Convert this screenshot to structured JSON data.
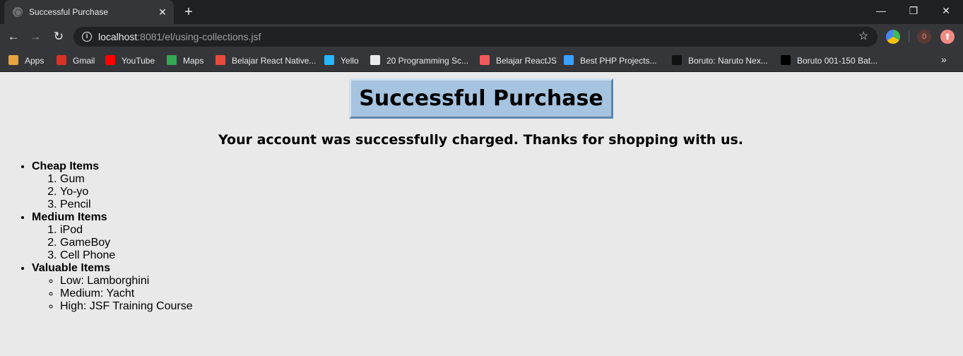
{
  "browser": {
    "tab": {
      "title": "Successful Purchase",
      "close": "✕"
    },
    "new_tab": "+",
    "window": {
      "minimize": "—",
      "maximize": "❐",
      "close": "✕"
    },
    "nav": {
      "back": "←",
      "forward": "→",
      "reload": "↻"
    },
    "address": {
      "host": "localhost",
      "rest": ":8081/el/using-collections.jsf"
    },
    "extension_badge": "0",
    "bookmarks": [
      {
        "label": "Apps",
        "icon": "apps-grid-icon",
        "color": "#e8a33d"
      },
      {
        "label": "Gmail",
        "icon": "gmail-icon",
        "color": "#d93025"
      },
      {
        "label": "YouTube",
        "icon": "youtube-icon",
        "color": "#ff0000"
      },
      {
        "label": "Maps",
        "icon": "maps-icon",
        "color": "#34a853"
      },
      {
        "label": "Belajar React Native...",
        "icon": "dw-icon",
        "color": "#e94b3c"
      },
      {
        "label": "Yello",
        "icon": "yello-icon",
        "color": "#29b6f6"
      },
      {
        "label": "20 Programming Sc...",
        "icon": "globe-icon",
        "color": "#e8eaed"
      },
      {
        "label": "Belajar ReactJS",
        "icon": "react-icon",
        "color": "#f05a5a"
      },
      {
        "label": "Best PHP Projects...",
        "icon": "nsc-icon",
        "color": "#3aa0ff"
      },
      {
        "label": "Boruto: Naruto Nex...",
        "icon": "cat-icon",
        "color": "#111111"
      },
      {
        "label": "Boruto 001-150 Bat...",
        "icon": "question-icon",
        "color": "#000000"
      }
    ],
    "bookmarks_more": "»"
  },
  "page": {
    "title": "Successful Purchase",
    "message": "Your account was successfully charged. Thanks for shopping with us.",
    "categories": [
      {
        "name": "Cheap Items",
        "items": [
          "Gum",
          "Yo-yo",
          "Pencil"
        ]
      },
      {
        "name": "Medium Items",
        "items": [
          "iPod",
          "GameBoy",
          "Cell Phone"
        ]
      },
      {
        "name": "Valuable Items",
        "items": [
          "Low: Lamborghini",
          "Medium: Yacht",
          "High: JSF Training Course"
        ]
      }
    ]
  }
}
